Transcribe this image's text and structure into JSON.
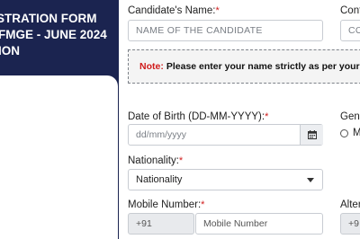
{
  "sidebar": {
    "title_lines": [
      "STRATION FORM",
      "FMGE - JUNE 2024",
      "ION"
    ]
  },
  "form": {
    "candidate_name": {
      "label": "Candidate's Name:",
      "required_mark": "*",
      "placeholder": "NAME OF THE CANDIDATE"
    },
    "confirm_name": {
      "label": "Confi",
      "placeholder": "CO"
    },
    "note": {
      "key": "Note:",
      "text": "Please enter your name strictly as per your eligible c"
    },
    "dob": {
      "label": "Date of Birth (DD-MM-YYYY):",
      "required_mark": "*",
      "placeholder": "dd/mm/yyyy",
      "calendar_icon": "calendar-icon"
    },
    "gender": {
      "label": "Genc",
      "option_label": "M"
    },
    "nationality": {
      "label": "Nationality:",
      "required_mark": "*",
      "selected": "Nationality"
    },
    "mobile": {
      "label": "Mobile Number:",
      "required_mark": "*",
      "prefix": "+91",
      "placeholder": "Mobile Number"
    },
    "alternate": {
      "label": "Alter",
      "prefix": "+9"
    }
  },
  "colors": {
    "sidebar_bg": "#1b2450",
    "required": "#d01c1c",
    "note_bg": "#f4f4f4"
  }
}
